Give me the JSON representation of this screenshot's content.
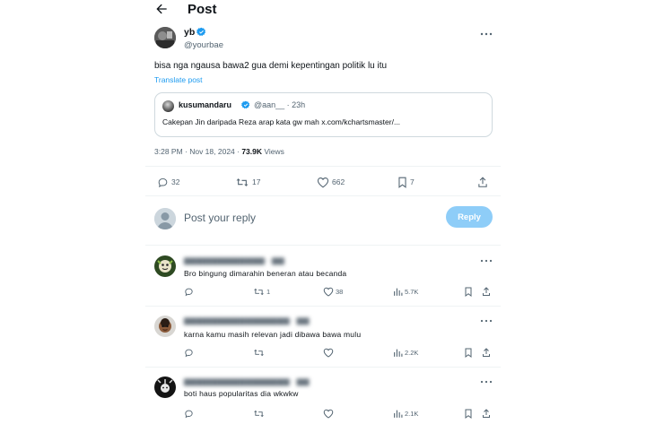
{
  "header": {
    "title": "Post",
    "back_icon": "arrow-left-icon"
  },
  "post": {
    "author_name": "yb",
    "author_handle": "@yourbae",
    "verified_color": "#1d9bf0",
    "text": "bisa nga ngausa bawa2 gua demi kepentingan politik lu itu",
    "translate_label": "Translate post",
    "quote": {
      "name": "kusumandaru",
      "handle": "@aan__ · 23h",
      "text": "Cakepan Jin daripada Reza arap kata gw mah x.com/kchartsmaster/..."
    },
    "timestamp": "3:28 PM · Nov 18, 2024 · ",
    "views_count": "73.9K",
    "views_label": " Views",
    "actions": {
      "replies": "32",
      "reposts": "17",
      "likes": "662",
      "bookmarks": "7"
    }
  },
  "compose": {
    "placeholder": "Post your reply",
    "button_label": "Reply",
    "button_color": "#8ecdf8"
  },
  "replies": [
    {
      "name_blurred": "▆▆▆▆▆▆▆▆▆▆▆▆▆ · ▆▆",
      "text": "Bro bingung dimarahin beneran atau becanda",
      "stats": {
        "replies": "",
        "reposts": "1",
        "likes": "38",
        "views": "5.7K"
      }
    },
    {
      "name_blurred": "▆▆▆▆▆▆▆▆▆▆▆▆▆▆▆▆▆ · ▆▆",
      "text": "karna kamu masih relevan jadi dibawa bawa mulu",
      "stats": {
        "replies": "",
        "reposts": "",
        "likes": "",
        "views": "2.2K"
      }
    },
    {
      "name_blurred": "▆▆▆▆▆▆▆▆▆▆▆▆▆▆▆▆▆ · ▆▆",
      "text": "boti haus popularitas dia wkwkw",
      "stats": {
        "replies": "",
        "reposts": "",
        "likes": "",
        "views": "2.1K"
      }
    }
  ]
}
